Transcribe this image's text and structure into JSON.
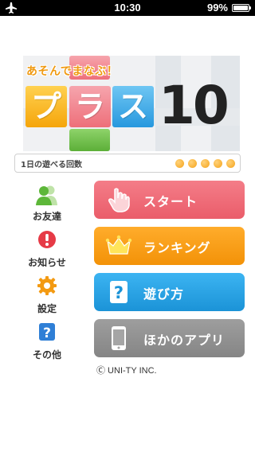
{
  "status_bar": {
    "time": "10:30",
    "battery": "99%",
    "airplane_icon": "airplane-icon"
  },
  "banner": {
    "title": "あそんでまなぶ！",
    "letters": [
      "プ",
      "ラ",
      "ス"
    ],
    "number": "10",
    "colors": {
      "yellow": "#f5a50b",
      "pink": "#ee6f7a",
      "blue": "#2798de",
      "green": "#5caf38",
      "title": "#f09a12"
    }
  },
  "daily_plays": {
    "label": "1日の遊べる回数",
    "remaining": 5,
    "dot_color": "#f5a31a"
  },
  "side_menu": [
    {
      "label": "お友達",
      "icon": "friends-icon"
    },
    {
      "label": "お知らせ",
      "icon": "info-icon"
    },
    {
      "label": "設定",
      "icon": "gear-icon"
    },
    {
      "label": "その他",
      "icon": "question-icon"
    }
  ],
  "buttons": {
    "start": {
      "label": "スタート",
      "icon": "hand-pointer-icon",
      "color": "#ea5d6a"
    },
    "ranking": {
      "label": "ランキング",
      "icon": "crown-icon",
      "color": "#f39208"
    },
    "howto": {
      "label": "遊び方",
      "icon": "question-icon",
      "color": "#1b93d7"
    },
    "apps": {
      "label": "ほかのアプリ",
      "icon": "smartphone-icon",
      "color": "#858585"
    }
  },
  "copyright": "Ⓒ UNI-TY INC."
}
